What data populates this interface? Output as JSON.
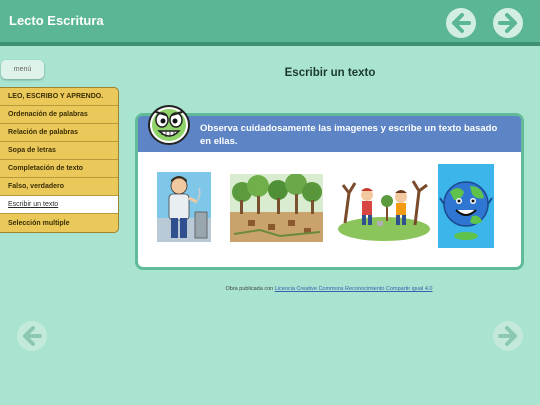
{
  "header": {
    "title": "Lecto Escritura"
  },
  "menu": {
    "label": "menú"
  },
  "sidebar": {
    "items": [
      {
        "label": "LEO, ESCRIBO Y APRENDO."
      },
      {
        "label": "Ordenación de palabras"
      },
      {
        "label": "Relación de palabras"
      },
      {
        "label": "Sopa de letras"
      },
      {
        "label": "Completación de texto"
      },
      {
        "label": "Falso, verdadero"
      },
      {
        "label": "Escribir un texto",
        "active": true
      },
      {
        "label": "Selección multiple"
      }
    ]
  },
  "page": {
    "title": "Escribir un texto",
    "instruction": "Observa cuidadosamente las imagenes y escribe un texto basado en ellas."
  },
  "footer": {
    "prefix": "Obra publicada con ",
    "license": "Licencia Creative Commons Reconocimiento Compartir igual 4.0"
  },
  "colors": {
    "background": "#a8e4d0",
    "topbar": "#5ab694",
    "sidebar": "#eac95a",
    "card_header": "#5d85c6"
  }
}
